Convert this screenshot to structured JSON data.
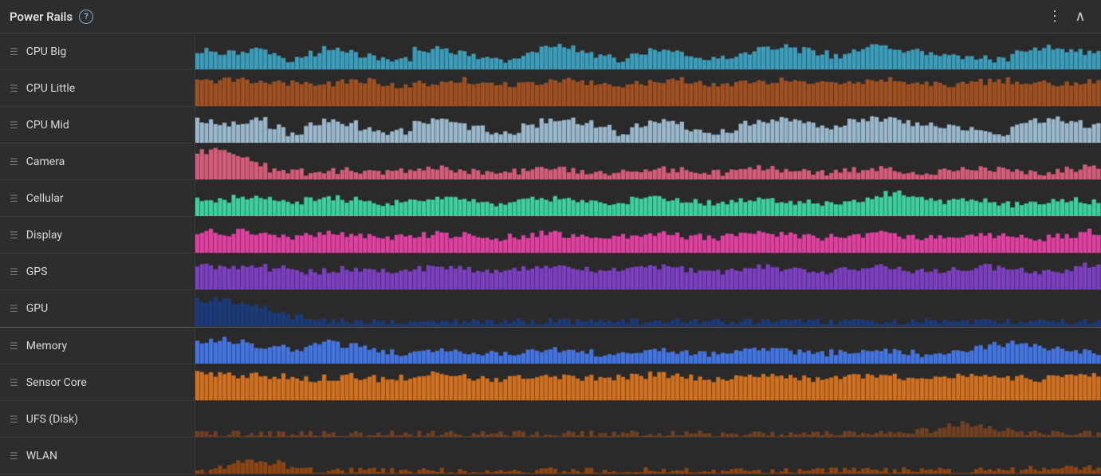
{
  "header": {
    "title": "Power Rails",
    "help_label": "?",
    "more_icon": "⋮",
    "collapse_icon": "∧"
  },
  "sidebar": {
    "items": [
      {
        "label": "CPU Big",
        "color": "#3b9dba"
      },
      {
        "label": "CPU Little",
        "color": "#8b4513"
      },
      {
        "label": "CPU Mid",
        "color": "#9ab8cc"
      },
      {
        "label": "Camera",
        "color": "#d45c7a"
      },
      {
        "label": "Cellular",
        "color": "#3ecfa0"
      },
      {
        "label": "Display",
        "color": "#e040a0"
      },
      {
        "label": "GPS",
        "color": "#7b3fc0"
      },
      {
        "label": "GPU",
        "color": "#1a3a7a"
      },
      {
        "label": "Memory",
        "color": "#4374e0"
      },
      {
        "label": "Sensor Core",
        "color": "#d07020"
      },
      {
        "label": "UFS (Disk)",
        "color": "#704020"
      },
      {
        "label": "WLAN",
        "color": "#8b4513"
      }
    ]
  },
  "charts": [
    {
      "color": "#3b9dba",
      "baseLevel": 0.15,
      "spikes": [
        0.6,
        0.5,
        0.55,
        0.7,
        0.45,
        0.3,
        0.5,
        0.65,
        0.55,
        0.4,
        0.3,
        0.35,
        0.6,
        0.7,
        0.55,
        0.4,
        0.35,
        0.3,
        0.5,
        0.65,
        0.7,
        0.55,
        0.45,
        0.3,
        0.5,
        0.6,
        0.55,
        0.4,
        0.35,
        0.3,
        0.55,
        0.65,
        0.7,
        0.6,
        0.5,
        0.4,
        0.6,
        0.7,
        0.65,
        0.55,
        0.5,
        0.45,
        0.4,
        0.35,
        0.3,
        0.5,
        0.65,
        0.7,
        0.6,
        0.5
      ],
      "type": "spike"
    },
    {
      "color": "#a05020",
      "baseLevel": 0.55,
      "spikes": [
        0.75,
        0.8,
        0.85,
        0.8,
        0.75,
        0.7,
        0.65,
        0.7,
        0.75,
        0.8,
        0.7,
        0.65,
        0.7,
        0.75,
        0.8,
        0.75,
        0.7,
        0.65,
        0.7,
        0.75,
        0.8,
        0.75,
        0.7,
        0.65,
        0.7,
        0.75,
        0.8,
        0.75,
        0.7,
        0.65,
        0.7,
        0.75,
        0.8,
        0.75,
        0.7,
        0.65,
        0.7,
        0.75,
        0.8,
        0.75,
        0.7,
        0.65,
        0.7,
        0.75,
        0.8,
        0.75,
        0.7,
        0.65,
        0.7,
        0.75
      ],
      "type": "fill"
    },
    {
      "color": "#9ab8cc",
      "baseLevel": 0.1,
      "spikes": [
        0.7,
        0.6,
        0.65,
        0.75,
        0.5,
        0.3,
        0.55,
        0.7,
        0.6,
        0.45,
        0.3,
        0.35,
        0.65,
        0.75,
        0.6,
        0.45,
        0.35,
        0.3,
        0.55,
        0.7,
        0.75,
        0.6,
        0.5,
        0.3,
        0.55,
        0.65,
        0.6,
        0.45,
        0.35,
        0.3,
        0.6,
        0.7,
        0.75,
        0.65,
        0.55,
        0.45,
        0.65,
        0.75,
        0.7,
        0.6,
        0.55,
        0.5,
        0.45,
        0.4,
        0.3,
        0.55,
        0.7,
        0.75,
        0.65,
        0.55
      ],
      "type": "spike"
    },
    {
      "color": "#d45c7a",
      "baseLevel": 0.2,
      "spikes": [
        0.85,
        0.9,
        0.75,
        0.5,
        0.3,
        0.25,
        0.2,
        0.25,
        0.3,
        0.25,
        0.2,
        0.25,
        0.3,
        0.35,
        0.3,
        0.25,
        0.2,
        0.25,
        0.3,
        0.35,
        0.3,
        0.25,
        0.2,
        0.25,
        0.3,
        0.35,
        0.3,
        0.25,
        0.2,
        0.25,
        0.3,
        0.35,
        0.3,
        0.25,
        0.2,
        0.25,
        0.3,
        0.35,
        0.3,
        0.25,
        0.2,
        0.25,
        0.3,
        0.35,
        0.3,
        0.25,
        0.2,
        0.25,
        0.3,
        0.4
      ],
      "type": "fill"
    },
    {
      "color": "#3ecfa0",
      "baseLevel": 0.25,
      "spikes": [
        0.55,
        0.5,
        0.6,
        0.55,
        0.5,
        0.45,
        0.5,
        0.55,
        0.5,
        0.45,
        0.4,
        0.45,
        0.5,
        0.55,
        0.5,
        0.45,
        0.4,
        0.45,
        0.5,
        0.55,
        0.5,
        0.45,
        0.4,
        0.45,
        0.5,
        0.55,
        0.5,
        0.45,
        0.4,
        0.45,
        0.5,
        0.55,
        0.5,
        0.45,
        0.4,
        0.45,
        0.5,
        0.6,
        0.7,
        0.65,
        0.55,
        0.45,
        0.5,
        0.45,
        0.4,
        0.35,
        0.4,
        0.45,
        0.5,
        0.45
      ],
      "type": "fill"
    },
    {
      "color": "#e040a0",
      "baseLevel": 0.15,
      "spikes": [
        0.65,
        0.6,
        0.65,
        0.55,
        0.5,
        0.45,
        0.55,
        0.6,
        0.55,
        0.5,
        0.45,
        0.5,
        0.55,
        0.6,
        0.55,
        0.5,
        0.45,
        0.5,
        0.55,
        0.6,
        0.55,
        0.5,
        0.45,
        0.5,
        0.55,
        0.6,
        0.55,
        0.5,
        0.45,
        0.5,
        0.55,
        0.6,
        0.55,
        0.5,
        0.45,
        0.5,
        0.55,
        0.6,
        0.55,
        0.5,
        0.45,
        0.5,
        0.55,
        0.6,
        0.55,
        0.5,
        0.45,
        0.5,
        0.55,
        0.65
      ],
      "type": "fill"
    },
    {
      "color": "#7b3fc0",
      "baseLevel": 0.3,
      "spikes": [
        0.75,
        0.7,
        0.65,
        0.7,
        0.65,
        0.6,
        0.55,
        0.6,
        0.65,
        0.6,
        0.55,
        0.6,
        0.65,
        0.7,
        0.65,
        0.6,
        0.55,
        0.6,
        0.65,
        0.7,
        0.65,
        0.6,
        0.55,
        0.6,
        0.65,
        0.7,
        0.65,
        0.6,
        0.55,
        0.6,
        0.65,
        0.7,
        0.65,
        0.6,
        0.55,
        0.6,
        0.65,
        0.7,
        0.65,
        0.6,
        0.55,
        0.6,
        0.65,
        0.7,
        0.65,
        0.6,
        0.55,
        0.6,
        0.65,
        0.75
      ],
      "type": "fill"
    },
    {
      "color": "#1a3a7a",
      "baseLevel": 0.1,
      "spikes": [
        0.8,
        0.85,
        0.75,
        0.6,
        0.4,
        0.3,
        0.2,
        0.15,
        0.15,
        0.15,
        0.15,
        0.15,
        0.15,
        0.15,
        0.15,
        0.15,
        0.15,
        0.15,
        0.15,
        0.15,
        0.15,
        0.15,
        0.15,
        0.15,
        0.15,
        0.15,
        0.15,
        0.15,
        0.15,
        0.15,
        0.15,
        0.15,
        0.15,
        0.15,
        0.15,
        0.15,
        0.15,
        0.15,
        0.15,
        0.15,
        0.15,
        0.15,
        0.15,
        0.15,
        0.15,
        0.15,
        0.15,
        0.15,
        0.15,
        0.15
      ],
      "type": "fill"
    },
    {
      "color": "#4374e0",
      "baseLevel": 0.1,
      "spikes": [
        0.7,
        0.75,
        0.65,
        0.55,
        0.5,
        0.45,
        0.6,
        0.65,
        0.55,
        0.5,
        0.35,
        0.3,
        0.35,
        0.45,
        0.4,
        0.35,
        0.3,
        0.35,
        0.4,
        0.45,
        0.4,
        0.35,
        0.3,
        0.35,
        0.4,
        0.45,
        0.4,
        0.35,
        0.3,
        0.35,
        0.4,
        0.45,
        0.4,
        0.35,
        0.3,
        0.35,
        0.4,
        0.45,
        0.4,
        0.35,
        0.3,
        0.35,
        0.4,
        0.5,
        0.6,
        0.65,
        0.55,
        0.45,
        0.4,
        0.35
      ],
      "type": "spike"
    },
    {
      "color": "#d07020",
      "baseLevel": 0.45,
      "spikes": [
        0.85,
        0.8,
        0.75,
        0.8,
        0.75,
        0.7,
        0.65,
        0.7,
        0.75,
        0.7,
        0.65,
        0.7,
        0.75,
        0.8,
        0.75,
        0.7,
        0.65,
        0.7,
        0.75,
        0.8,
        0.75,
        0.7,
        0.65,
        0.7,
        0.75,
        0.8,
        0.75,
        0.7,
        0.65,
        0.7,
        0.75,
        0.8,
        0.75,
        0.7,
        0.65,
        0.7,
        0.75,
        0.8,
        0.75,
        0.7,
        0.65,
        0.7,
        0.75,
        0.8,
        0.75,
        0.7,
        0.65,
        0.7,
        0.75,
        0.8
      ],
      "type": "fill"
    },
    {
      "color": "#704020",
      "baseLevel": 0.05,
      "spikes": [
        0.1,
        0.1,
        0.1,
        0.1,
        0.1,
        0.1,
        0.1,
        0.1,
        0.1,
        0.1,
        0.1,
        0.1,
        0.1,
        0.1,
        0.1,
        0.1,
        0.1,
        0.1,
        0.1,
        0.1,
        0.1,
        0.1,
        0.1,
        0.1,
        0.1,
        0.1,
        0.1,
        0.1,
        0.1,
        0.1,
        0.1,
        0.1,
        0.1,
        0.1,
        0.1,
        0.1,
        0.1,
        0.1,
        0.1,
        0.15,
        0.2,
        0.35,
        0.4,
        0.3,
        0.2,
        0.15,
        0.1,
        0.1,
        0.1,
        0.1
      ],
      "type": "fill"
    },
    {
      "color": "#8b4513",
      "baseLevel": 0.05,
      "spikes": [
        0.1,
        0.2,
        0.35,
        0.4,
        0.35,
        0.2,
        0.1,
        0.1,
        0.1,
        0.1,
        0.1,
        0.1,
        0.1,
        0.1,
        0.1,
        0.1,
        0.1,
        0.1,
        0.1,
        0.1,
        0.1,
        0.1,
        0.1,
        0.1,
        0.1,
        0.1,
        0.1,
        0.1,
        0.1,
        0.1,
        0.1,
        0.1,
        0.1,
        0.1,
        0.1,
        0.1,
        0.1,
        0.1,
        0.1,
        0.1,
        0.1,
        0.1,
        0.1,
        0.1,
        0.1,
        0.1,
        0.15,
        0.2,
        0.15,
        0.2
      ],
      "type": "fill"
    }
  ]
}
